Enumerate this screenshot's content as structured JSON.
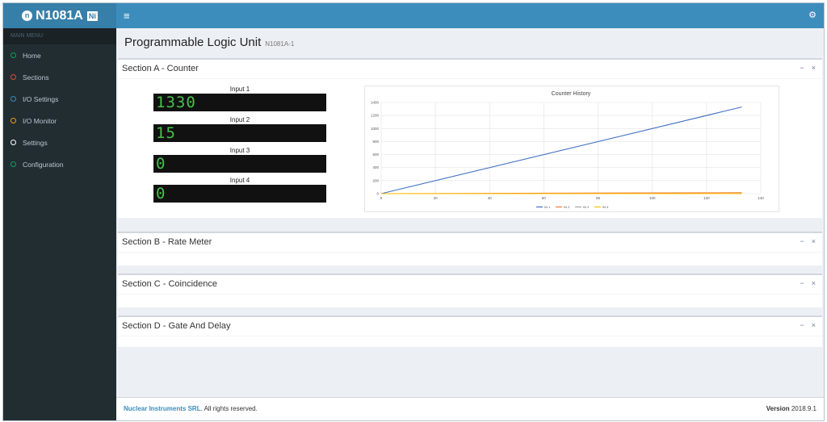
{
  "brand": {
    "name": "N1081A",
    "logo_letter": "n",
    "badge": "Ni"
  },
  "sidebar": {
    "header": "MAIN MENU",
    "items": [
      {
        "label": "Home",
        "color": "#00a65a"
      },
      {
        "label": "Sections",
        "color": "#dd4b39"
      },
      {
        "label": "I/O Settings",
        "color": "#3c8dbc"
      },
      {
        "label": "I/O Monitor",
        "color": "#f39c12"
      },
      {
        "label": "Settings",
        "color": "#ffffff"
      },
      {
        "label": "Configuration",
        "color": "#00a65a"
      }
    ]
  },
  "page": {
    "title": "Programmable Logic Unit",
    "subtitle": "N1081A-1"
  },
  "sections": [
    {
      "title": "Section A - Counter"
    },
    {
      "title": "Section B - Rate Meter"
    },
    {
      "title": "Section C - Coincidence"
    },
    {
      "title": "Section D - Gate And Delay"
    }
  ],
  "box_tools": {
    "minimize": "−",
    "close": "×"
  },
  "counters": [
    {
      "label": "Input 1",
      "value": "1330"
    },
    {
      "label": "Input 2",
      "value": "15"
    },
    {
      "label": "Input 3",
      "value": "0"
    },
    {
      "label": "Input 4",
      "value": "0"
    }
  ],
  "chart_data": {
    "type": "line",
    "title": "Counter History",
    "xlim": [
      0,
      140
    ],
    "ylim": [
      0,
      1400
    ],
    "xticks": [
      0,
      20,
      40,
      60,
      80,
      100,
      120,
      140
    ],
    "yticks": [
      0,
      200,
      400,
      600,
      800,
      1000,
      1200,
      1400
    ],
    "grid": true,
    "legend": "bottom",
    "series": [
      {
        "name": "IN 1",
        "color": "#4472c4",
        "x": [
          0,
          133
        ],
        "y": [
          0,
          1330
        ]
      },
      {
        "name": "IN 2",
        "color": "#ed7d31",
        "x": [
          0,
          133
        ],
        "y": [
          0,
          15
        ]
      },
      {
        "name": "IN 3",
        "color": "#a5a5a5",
        "x": [
          0,
          133
        ],
        "y": [
          0,
          0
        ]
      },
      {
        "name": "IN 4",
        "color": "#ffc000",
        "x": [
          0,
          133
        ],
        "y": [
          0,
          0
        ]
      }
    ]
  },
  "footer": {
    "company": "Nuclear Instruments SRL",
    "rights": ". All rights reserved.",
    "version_label": "Version",
    "version": "2018.9.1"
  }
}
